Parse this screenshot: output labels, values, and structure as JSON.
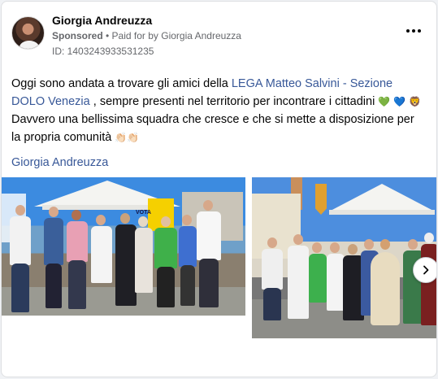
{
  "post": {
    "author": "Giorgia Andreuzza",
    "sponsored": "Sponsored",
    "separator": " • ",
    "paid_for": "Paid for by Giorgia Andreuzza",
    "id_line": "ID: 1403243933531235",
    "text_part1": "Oggi sono andata a trovare gli amici della ",
    "link1": "LEGA Matteo Salvini - Sezione DOLO Venezia",
    "text_part2": " , sempre presenti nel territorio per incontrare i cittadini ",
    "emoji_heart_green": "💚",
    "emoji_heart_blue": "💙",
    "emoji_lion": "🦁",
    "text_part3": " Davvero una bellissima squadra che cresce e che si mette a disposizione per la propria comunità ",
    "emoji_hands": "👏🏻👏🏻",
    "author_link": "Giorgia Andreuzza"
  },
  "photo1": {
    "tent_sign": "VOTA"
  },
  "icons": {
    "more": "more-horizontal-icon",
    "next": "chevron-right-icon"
  },
  "colors": {
    "link": "#385898",
    "secondary_text": "#65676b"
  }
}
